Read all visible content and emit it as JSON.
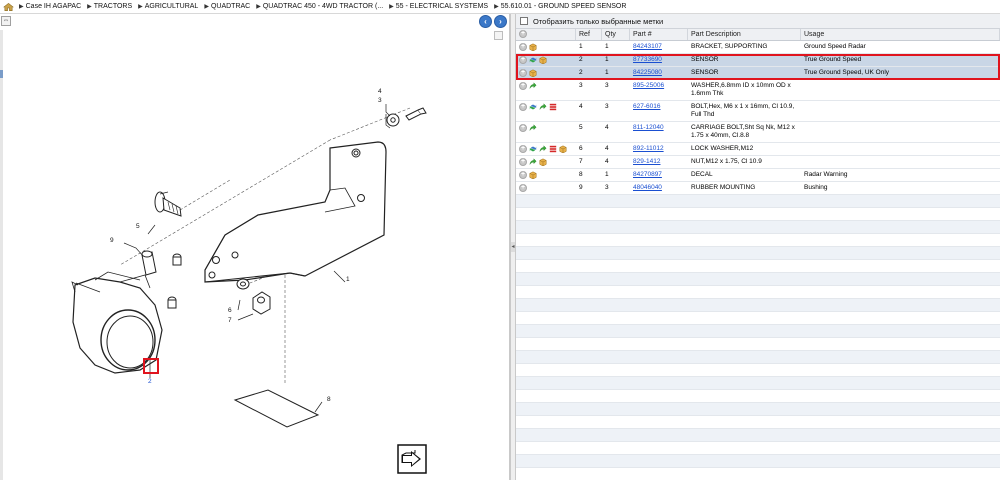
{
  "breadcrumb": {
    "items": [
      "Case IH AGAPAC",
      "TRACTORS",
      "AGRICULTURAL",
      "QUADTRAC",
      "QUADTRAC 450 - 4WD TRACTOR (...",
      "55 - ELECTRICAL SYSTEMS",
      "55.610.01 - GROUND SPEED SENSOR"
    ]
  },
  "diagram": {
    "callouts": [
      "1",
      "2",
      "3",
      "4",
      "5",
      "6",
      "7",
      "8",
      "9"
    ],
    "highlighted_ref": "2"
  },
  "parts_panel": {
    "filter_label": "Отобразить только выбранные метки",
    "columns": [
      "Ref",
      "Qty",
      "Part #",
      "Part Description",
      "Usage"
    ],
    "rows": [
      {
        "ref": "1",
        "qty": "1",
        "part": "84243107",
        "desc": "BRACKET, SUPPORTING",
        "usage": "Ground Speed Radar",
        "selected": false,
        "icons": [
          "add",
          "box"
        ]
      },
      {
        "ref": "2",
        "qty": "1",
        "part": "87733690",
        "desc": "SENSOR",
        "usage": "True Ground Speed",
        "selected": true,
        "icons": [
          "add",
          "swap",
          "box"
        ]
      },
      {
        "ref": "2",
        "qty": "1",
        "part": "84225080",
        "desc": "SENSOR",
        "usage": "True Ground Speed, UK Only",
        "selected": true,
        "icons": [
          "add",
          "box"
        ]
      },
      {
        "ref": "3",
        "qty": "3",
        "part": "895-25006",
        "desc": "WASHER,6.8mm ID x 10mm OD x 1.6mm Thk",
        "usage": "",
        "selected": false,
        "icons": [
          "add",
          "arrow"
        ]
      },
      {
        "ref": "4",
        "qty": "3",
        "part": "627-6016",
        "desc": "BOLT,Hex, M6 x 1 x 16mm, Cl 10.9, Full Thd",
        "usage": "",
        "selected": false,
        "icons": [
          "add",
          "swap",
          "arrow",
          "list"
        ]
      },
      {
        "ref": "5",
        "qty": "4",
        "part": "811-12040",
        "desc": "CARRIAGE BOLT,Sht Sq Nk, M12 x 1.75 x 40mm, Cl.8.8",
        "usage": "",
        "selected": false,
        "icons": [
          "add",
          "arrow"
        ]
      },
      {
        "ref": "6",
        "qty": "4",
        "part": "892-11012",
        "desc": "LOCK WASHER,M12",
        "usage": "",
        "selected": false,
        "icons": [
          "add",
          "swap",
          "arrow",
          "list",
          "box"
        ]
      },
      {
        "ref": "7",
        "qty": "4",
        "part": "829-1412",
        "desc": "NUT,M12 x 1.75, Cl 10.9",
        "usage": "",
        "selected": false,
        "icons": [
          "add",
          "arrow",
          "box"
        ]
      },
      {
        "ref": "8",
        "qty": "1",
        "part": "84270897",
        "desc": "DECAL",
        "usage": "Radar Warning",
        "selected": false,
        "icons": [
          "add",
          "box"
        ]
      },
      {
        "ref": "9",
        "qty": "3",
        "part": "48046040",
        "desc": "RUBBER MOUNTING",
        "usage": "Bushing",
        "selected": false,
        "icons": [
          "add"
        ]
      }
    ]
  },
  "colors": {
    "accent": "#3b78c8",
    "link": "#1a4fd1",
    "highlight": "#e0141e",
    "selected_row": "#c9d6e6"
  }
}
